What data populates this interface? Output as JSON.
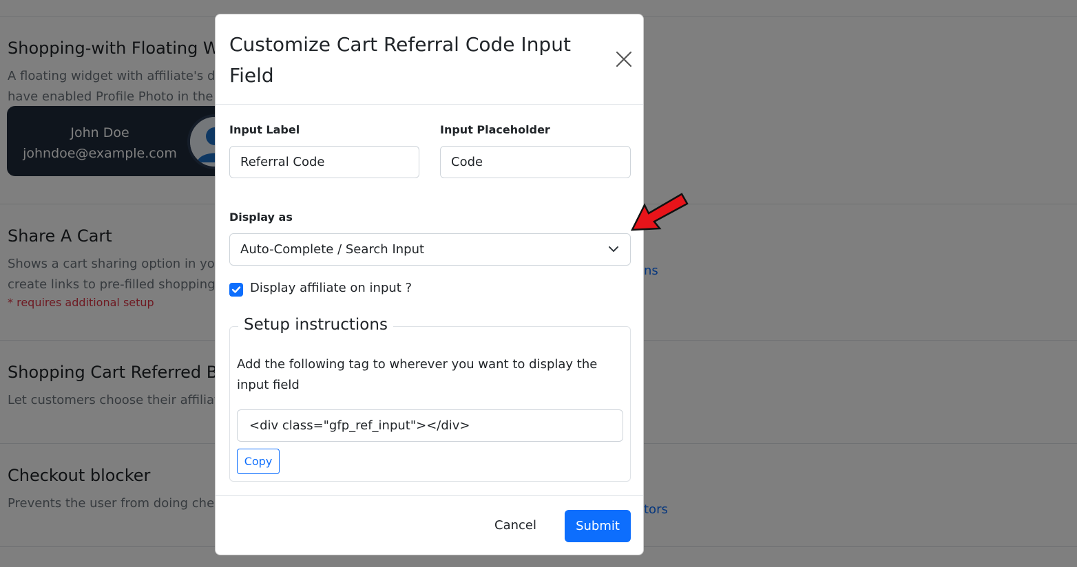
{
  "background": {
    "sections": [
      {
        "title": "Shopping-with Floating Wi",
        "desc_lines": [
          "A floating widget with affiliate's de",
          "have enabled Profile Photo in the s"
        ]
      },
      {
        "title": "Share A Cart",
        "desc_lines": [
          "Shows a cart sharing option in you",
          "create links to pre-filled shopping"
        ],
        "note": "* requires additional setup",
        "link": "ns"
      },
      {
        "title": "Shopping Cart Referred By",
        "desc_lines": [
          "Let customers choose their affiliate"
        ]
      },
      {
        "title": "Checkout blocker",
        "desc_lines": [
          "Prevents the user from doing chec"
        ],
        "link": "tors"
      }
    ],
    "widget": {
      "name": "John Doe",
      "email": "johndoe@example.com"
    }
  },
  "modal": {
    "title": "Customize Cart Referral Code Input Field",
    "input_label": {
      "label": "Input Label",
      "value": "Referral Code"
    },
    "input_placeholder": {
      "label": "Input Placeholder",
      "value": "Code"
    },
    "display_as": {
      "label": "Display as",
      "selected": "Auto-Complete / Search Input"
    },
    "checkbox": {
      "label": "Display affiliate on input ?",
      "checked": true
    },
    "setup": {
      "legend": "Setup instructions",
      "text": "Add the following tag to wherever you want to display the input field",
      "code": "<div class=\"gfp_ref_input\"></div>",
      "copy_label": "Copy"
    },
    "footer": {
      "cancel_label": "Cancel",
      "submit_label": "Submit"
    }
  },
  "colors": {
    "primary": "#0d6efd",
    "arrow": "#e8141a",
    "danger": "#dc3545"
  }
}
